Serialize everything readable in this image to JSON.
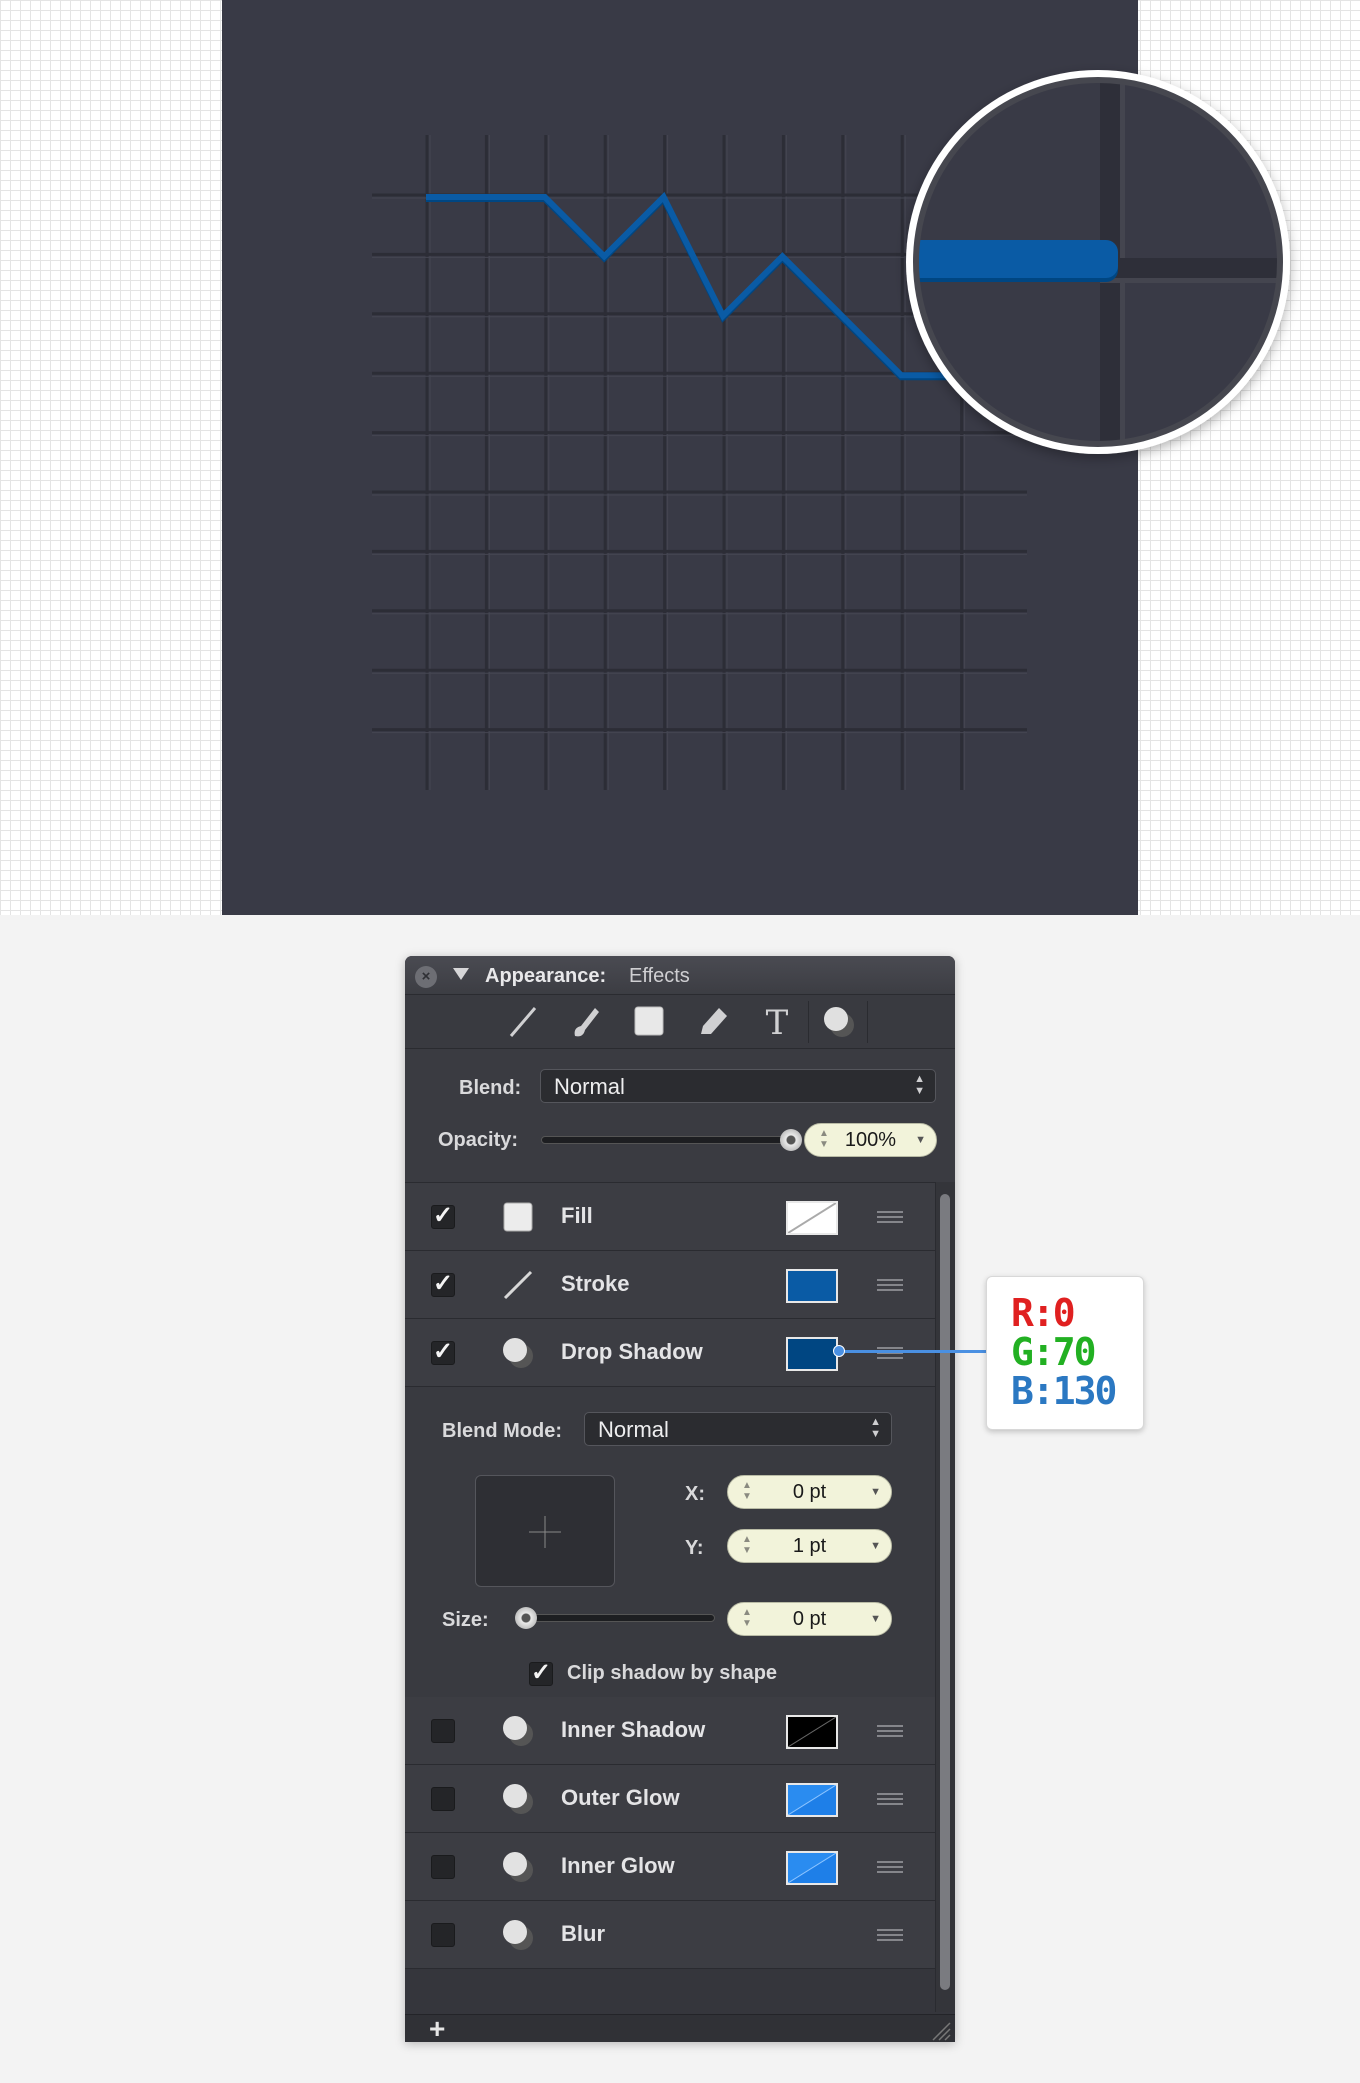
{
  "panel": {
    "title": "Appearance:",
    "subtitle": "Effects",
    "blend_label": "Blend:",
    "blend_value": "Normal",
    "opacity_label": "Opacity:",
    "opacity_value": "100%",
    "opacity_fraction": 1.0,
    "tools": [
      "line-tool-icon",
      "brush-tool-icon",
      "fill-tool-icon",
      "pencil-tool-icon",
      "text-tool-icon",
      "effects-tool-icon"
    ],
    "effects": [
      {
        "name": "Fill",
        "checked": true,
        "icon": "fill-icon",
        "swatch": "none"
      },
      {
        "name": "Stroke",
        "checked": true,
        "icon": "stroke-icon",
        "swatch": "#0a5ba5"
      },
      {
        "name": "Drop Shadow",
        "checked": true,
        "icon": "drop-shadow-icon",
        "swatch": "#004682"
      },
      {
        "name": "Inner Shadow",
        "checked": false,
        "icon": "inner-shadow-icon",
        "swatch": "#000000"
      },
      {
        "name": "Outer Glow",
        "checked": false,
        "icon": "outer-glow-icon",
        "swatch": "#1e90ff"
      },
      {
        "name": "Inner Glow",
        "checked": false,
        "icon": "inner-glow-icon",
        "swatch": "#1e90ff"
      },
      {
        "name": "Blur",
        "checked": false,
        "icon": "blur-icon",
        "swatch": null
      }
    ],
    "shadow": {
      "blend_mode_label": "Blend Mode:",
      "blend_mode_value": "Normal",
      "x_label": "X:",
      "x_value": "0 pt",
      "y_label": "Y:",
      "y_value": "1 pt",
      "size_label": "Size:",
      "size_value": "0 pt",
      "size_fraction": 0,
      "clip_label": "Clip shadow by shape",
      "clip_checked": true
    },
    "check_glyph": "✓",
    "close_glyph": "×",
    "add_glyph": "+"
  },
  "callout": {
    "r": "R:0",
    "g": "G:70",
    "b": "B:130"
  },
  "colors": {
    "artboard": "#393a46",
    "line": "#0a5ba5",
    "shadow": "#004682",
    "callout_r": "#e02020",
    "callout_g": "#22b022",
    "callout_b": "#2b78c2"
  },
  "chart_data": {
    "type": "line",
    "x": [
      0,
      2,
      3,
      4,
      5,
      6,
      7,
      8,
      9
    ],
    "y": [
      7,
      7,
      6,
      7,
      5,
      6,
      5,
      4,
      4
    ],
    "title": "",
    "xlabel": "",
    "ylabel": "",
    "xlim": [
      0,
      11
    ],
    "ylim": [
      0,
      10
    ],
    "grid": true,
    "series": [
      {
        "values": [
          7,
          7,
          6,
          7,
          5,
          6,
          5,
          4,
          4
        ],
        "color": "#0a5ba5"
      }
    ]
  }
}
